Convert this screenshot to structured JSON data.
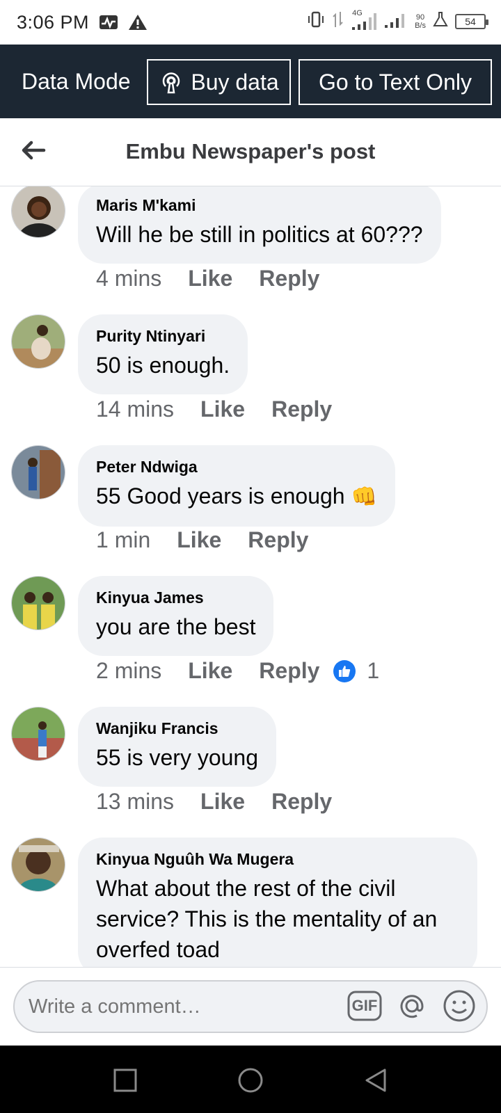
{
  "status_bar": {
    "time": "3:06 PM",
    "network": "4G",
    "speed_value": "90",
    "speed_unit": "B/s",
    "battery": "54"
  },
  "data_bar": {
    "mode_label": "Data Mode",
    "buy_label": "Buy data",
    "text_only_label": "Go to Text Only"
  },
  "header": {
    "title": "Embu Newspaper's post"
  },
  "comments": [
    {
      "author": "Maris M'kami",
      "text": "Will he be still in politics at 60???",
      "time": "4 mins",
      "like": "Like",
      "reply": "Reply"
    },
    {
      "author": "Purity Ntinyari",
      "text": "50 is enough.",
      "time": "14 mins",
      "like": "Like",
      "reply": "Reply"
    },
    {
      "author": "Peter Ndwiga",
      "text": "55 Good years is enough",
      "emoji": "👊",
      "time": "1 min",
      "like": "Like",
      "reply": "Reply"
    },
    {
      "author": "Kinyua James",
      "text": "you are the best",
      "time": "2 mins",
      "like": "Like",
      "reply": "Reply",
      "reactions": "1"
    },
    {
      "author": "Wanjiku Francis",
      "text": "55 is very young",
      "time": "13 mins",
      "like": "Like",
      "reply": "Reply"
    },
    {
      "author": "Kinyua Nguûh Wa Mugera",
      "text_lines": [
        "What about the rest of the civil",
        "service? This is the mentality of an",
        "overfed toad"
      ]
    }
  ],
  "composer": {
    "placeholder": "Write a comment…",
    "gif_label": "GIF"
  },
  "colors": {
    "data_bar_bg": "#1c2733",
    "bubble_bg": "#f0f2f5",
    "secondary_text": "#65676b",
    "like_blue": "#1877f2"
  }
}
